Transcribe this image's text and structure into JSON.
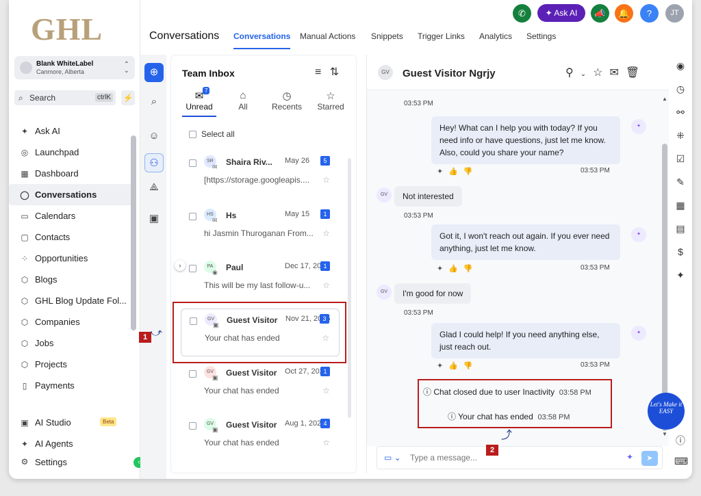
{
  "logo": "GHL",
  "account": {
    "name": "Blank WhiteLabel",
    "location": "Canmore, Alberta"
  },
  "search": {
    "label": "Search",
    "shortcut": "ctrlK"
  },
  "nav": [
    {
      "label": "Ask AI",
      "icon": "✦"
    },
    {
      "label": "Launchpad",
      "icon": "◎"
    },
    {
      "label": "Dashboard",
      "icon": "▦"
    },
    {
      "label": "Conversations",
      "icon": "◯"
    },
    {
      "label": "Calendars",
      "icon": "▭"
    },
    {
      "label": "Contacts",
      "icon": "▢"
    },
    {
      "label": "Opportunities",
      "icon": "⁘"
    },
    {
      "label": "Blogs",
      "icon": "⬡"
    },
    {
      "label": "GHL Blog Update Fol...",
      "icon": "⬡"
    },
    {
      "label": "Companies",
      "icon": "⬡"
    },
    {
      "label": "Jobs",
      "icon": "⬡"
    },
    {
      "label": "Projects",
      "icon": "⬡"
    },
    {
      "label": "Payments",
      "icon": "▯"
    }
  ],
  "nav_bottom": [
    {
      "label": "AI Studio",
      "icon": "▣",
      "badge": "Beta"
    },
    {
      "label": "AI Agents",
      "icon": "✦"
    },
    {
      "label": "Settings",
      "icon": "⚙"
    }
  ],
  "topbar": {
    "ask_ai": "✦ Ask AI",
    "user_initials": "JT"
  },
  "tabs": {
    "main": "Conversations",
    "items": [
      "Conversations",
      "Manual Actions",
      "Snippets",
      "Trigger Links",
      "Analytics",
      "Settings"
    ]
  },
  "inbox": {
    "title": "Team Inbox",
    "tabs": [
      {
        "label": "Unread",
        "icon": "✉",
        "badge": "7"
      },
      {
        "label": "All",
        "icon": "⌂"
      },
      {
        "label": "Recents",
        "icon": "◷"
      },
      {
        "label": "Starred",
        "icon": "☆"
      }
    ],
    "select_all": "Select all",
    "items": [
      {
        "initials": "SR",
        "name": "Shaira Riv...",
        "date": "May 26",
        "count": "5",
        "preview": "[https://storage.googleapis....",
        "avatar_color": "#e0e7ff",
        "sub": "✉"
      },
      {
        "initials": "HS",
        "name": "Hs",
        "date": "May 15",
        "count": "1",
        "preview": "hi Jasmin Thuroganan From...",
        "avatar_color": "#dbeafe",
        "sub": "✉"
      },
      {
        "initials": "PA",
        "name": "Paul",
        "date": "Dec 17, 2025",
        "count": "1",
        "preview": "This will be my last follow-u...",
        "avatar_color": "#dcfce7",
        "sub": "◉"
      },
      {
        "initials": "GV",
        "name": "Guest Visitor",
        "date": "Nov 21, 2025",
        "count": "3",
        "preview": "Your chat has ended",
        "avatar_color": "#ede9fe",
        "sub": "▣"
      },
      {
        "initials": "GV",
        "name": "Guest Visitor",
        "date": "Oct 27, 2025",
        "count": "1",
        "preview": "Your chat has ended",
        "avatar_color": "#fee2e2",
        "sub": "▣"
      },
      {
        "initials": "GV",
        "name": "Guest Visitor",
        "date": "Aug 1, 2025",
        "count": "4",
        "preview": "Your chat has ended",
        "avatar_color": "#dcfce7",
        "sub": "▣"
      }
    ]
  },
  "chat": {
    "initials": "GV",
    "name": "Guest Visitor Ngrjy",
    "messages": [
      {
        "dir": "out",
        "text": "Hey! What can I help you with today? If you need info or have questions, just let me know. Also, could you share your name?",
        "time": "03:53 PM"
      },
      {
        "dir": "in",
        "text": "Not interested",
        "time": "03:53 PM"
      },
      {
        "dir": "out",
        "text": "Got it, I won't reach out again. If you ever need anything, just let me know.",
        "time": "03:53 PM"
      },
      {
        "dir": "in",
        "text": "I'm good for now",
        "time": "03:53 PM"
      },
      {
        "dir": "out",
        "text": "Glad I could help! If you need anything else, just reach out.",
        "time": "03:53 PM"
      }
    ],
    "first_time": "03:53 PM",
    "system": [
      {
        "text": "Chat closed due to user Inactivity",
        "time": "03:58 PM"
      },
      {
        "text": "Your chat has ended",
        "time": "03:58 PM"
      }
    ],
    "compose_placeholder": "Type a message..."
  },
  "annotations": [
    "1",
    "2"
  ],
  "watermark": "Let's Make it EASY"
}
